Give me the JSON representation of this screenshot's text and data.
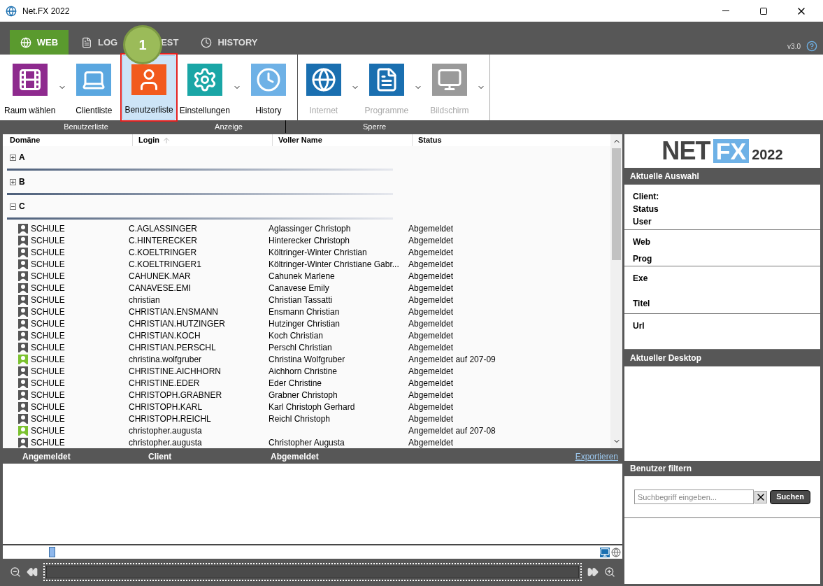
{
  "window": {
    "title": "Net.FX 2022"
  },
  "tabs": [
    {
      "label": "WEB",
      "kind": "globe",
      "selected": true
    },
    {
      "label": "LOG",
      "kind": "log",
      "selected": false
    },
    {
      "label": "EST",
      "kind": "plain",
      "selected": false
    },
    {
      "label": "HISTORY",
      "kind": "history",
      "selected": false
    }
  ],
  "callout": {
    "number": "1"
  },
  "version": "v3.0",
  "ribbon": {
    "groups": [
      {
        "label": "Benutzerliste",
        "buttons": [
          {
            "label": "Raum wählen",
            "kind": "room",
            "dropdown": true,
            "selected": false,
            "disabled": false
          },
          {
            "label": "Clientliste",
            "kind": "laptop",
            "dropdown": false,
            "selected": false,
            "disabled": false
          },
          {
            "label": "Benutzerliste",
            "kind": "user",
            "dropdown": false,
            "selected": true,
            "disabled": false
          }
        ]
      },
      {
        "label": "Anzeige",
        "buttons": [
          {
            "label": "Einstellungen",
            "kind": "gears",
            "dropdown": true,
            "selected": false,
            "disabled": false
          },
          {
            "label": "History",
            "kind": "history",
            "dropdown": false,
            "selected": false,
            "disabled": false
          }
        ]
      },
      {
        "label": "Sperre",
        "buttons": [
          {
            "label": "Internet",
            "kind": "globe",
            "dropdown": true,
            "selected": false,
            "disabled": true
          },
          {
            "label": "Programme",
            "kind": "programs",
            "dropdown": true,
            "selected": false,
            "disabled": true
          },
          {
            "label": "Bildschirm",
            "kind": "monitor",
            "dropdown": true,
            "selected": false,
            "disabled": true
          }
        ]
      }
    ]
  },
  "table": {
    "columns": [
      "Domäne",
      "Login",
      "Voller Name",
      "Status"
    ],
    "groups": [
      {
        "label": "A",
        "expanded": false
      },
      {
        "label": "B",
        "expanded": false
      },
      {
        "label": "C",
        "expanded": true,
        "rows": [
          {
            "online": false,
            "cells": [
              "SCHULE",
              "C.AGLASSINGER",
              "Aglassinger Christoph",
              "Abgemeldet"
            ]
          },
          {
            "online": false,
            "cells": [
              "SCHULE",
              "C.HINTERECKER",
              "Hinterecker Christoph",
              "Abgemeldet"
            ]
          },
          {
            "online": false,
            "cells": [
              "SCHULE",
              "C.KOELTRINGER",
              "Költringer-Winter Christian",
              "Abgemeldet"
            ]
          },
          {
            "online": false,
            "cells": [
              "SCHULE",
              "C.KOELTRINGER1",
              "Költringer-Winter Christiane Gabr...",
              "Abgemeldet"
            ]
          },
          {
            "online": false,
            "cells": [
              "SCHULE",
              "CAHUNEK.MAR",
              "Cahunek Marlene",
              "Abgemeldet"
            ]
          },
          {
            "online": false,
            "cells": [
              "SCHULE",
              "CANAVESE.EMI",
              "Canavese Emily",
              "Abgemeldet"
            ]
          },
          {
            "online": false,
            "cells": [
              "SCHULE",
              "christian",
              "Christian Tassatti",
              "Abgemeldet"
            ]
          },
          {
            "online": false,
            "cells": [
              "SCHULE",
              "CHRISTIAN.ENSMANN",
              "Ensmann Christian",
              "Abgemeldet"
            ]
          },
          {
            "online": false,
            "cells": [
              "SCHULE",
              "CHRISTIAN.HUTZINGER",
              "Hutzinger Christian",
              "Abgemeldet"
            ]
          },
          {
            "online": false,
            "cells": [
              "SCHULE",
              "CHRISTIAN.KOCH",
              "Koch Christian",
              "Abgemeldet"
            ]
          },
          {
            "online": false,
            "cells": [
              "SCHULE",
              "CHRISTIAN.PERSCHL",
              "Perschl Christian",
              "Abgemeldet"
            ]
          },
          {
            "online": true,
            "cells": [
              "SCHULE",
              "christina.wolfgruber",
              "Christina Wolfgruber",
              "Angemeldet auf 207-09"
            ]
          },
          {
            "online": false,
            "cells": [
              "SCHULE",
              "CHRISTINE.AICHHORN",
              "Aichhorn Christine",
              "Abgemeldet"
            ]
          },
          {
            "online": false,
            "cells": [
              "SCHULE",
              "CHRISTINE.EDER",
              "Eder Christine",
              "Abgemeldet"
            ]
          },
          {
            "online": false,
            "cells": [
              "SCHULE",
              "CHRISTOPH.GRABNER",
              "Grabner Christoph",
              "Abgemeldet"
            ]
          },
          {
            "online": false,
            "cells": [
              "SCHULE",
              "CHRISTOPH.KARL",
              "Karl Christoph Gerhard",
              "Abgemeldet"
            ]
          },
          {
            "online": false,
            "cells": [
              "SCHULE",
              "CHRISTOPH.REICHL",
              "Reichl Christoph",
              "Abgemeldet"
            ]
          },
          {
            "online": true,
            "cells": [
              "SCHULE",
              "christopher.augusta",
              "",
              "Angemeldet auf 207-08"
            ]
          },
          {
            "online": false,
            "cells": [
              "SCHULE",
              "christopher.augusta",
              "Christopher Augusta",
              "Abgemeldet"
            ]
          }
        ]
      }
    ]
  },
  "history": {
    "columns": [
      "Angemeldet",
      "Client",
      "Abgemeldet"
    ],
    "export_link": "Exportieren"
  },
  "side": {
    "logo": {
      "net": "NET",
      "fx": "FX",
      "year": "2022"
    },
    "selection": {
      "title": "Aktuelle Auswahl",
      "sections": [
        [
          "Client:",
          "Status",
          "User"
        ],
        [
          "Web",
          "Prog"
        ],
        [
          "Exe",
          "Titel"
        ],
        [
          "Url"
        ]
      ]
    },
    "desktop": {
      "title": "Aktueller Desktop"
    },
    "filter": {
      "title": "Benutzer filtern",
      "placeholder": "Suchbegriff eingeben...",
      "button": "Suchen"
    }
  }
}
